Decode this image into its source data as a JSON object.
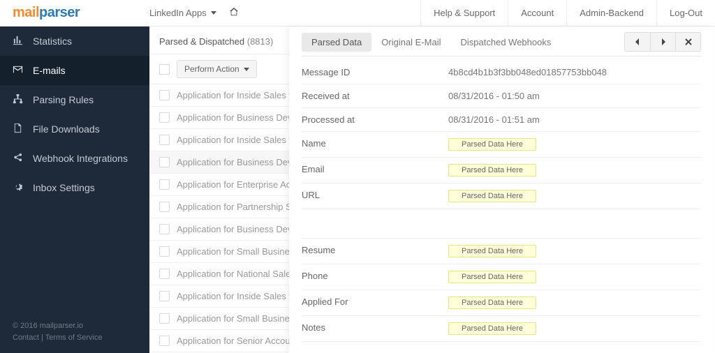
{
  "logo": {
    "a": "mail",
    "b": "parser"
  },
  "top": {
    "dropdown": "LinkedIn Apps",
    "menu": [
      "Help & Support",
      "Account",
      "Admin-Backend",
      "Log-Out"
    ]
  },
  "sidebar": {
    "items": [
      {
        "label": "Statistics"
      },
      {
        "label": "E-mails"
      },
      {
        "label": "Parsing Rules"
      },
      {
        "label": "File Downloads"
      },
      {
        "label": "Webhook Integrations"
      },
      {
        "label": "Inbox Settings"
      }
    ],
    "footer": {
      "copyright": "© 2016 mailparser.io",
      "contact": "Contact",
      "sep": " | ",
      "terms": "Terms of Service"
    }
  },
  "list": {
    "title": "Parsed & Dispatched",
    "count": "(8813)",
    "action_btn": "Perform Action",
    "rows": [
      "Application for Inside Sales from John Example",
      "Application for Business Development from John Example",
      "Application for Inside Sales from John Example",
      "Application for Business Development from John Example",
      "Application for Enterprise Account from John Example",
      "Application for Partnership Sales from John Example",
      "Application for Business Development from John Example",
      "Application for Small Business from John Example",
      "Application for National Sales from John Example",
      "Application for Inside Sales from John Example",
      "Application for Small Business from John Example",
      "Application for Senior Account from John Example"
    ],
    "selected_index": 3
  },
  "detail": {
    "tabs": [
      "Parsed Data",
      "Original E-Mail",
      "Dispatched Webhooks"
    ],
    "active_tab": 0,
    "placeholder": "Parsed Data Here",
    "fields1": [
      {
        "label": "Message ID",
        "value": "4b8cd4b1b3f3bb048ed01857753bb048",
        "parsed": false
      },
      {
        "label": "Received at",
        "value": "08/31/2016 - 01:50 am",
        "parsed": false
      },
      {
        "label": "Processed at",
        "value": "08/31/2016 - 01:51 am",
        "parsed": false
      },
      {
        "label": "Name",
        "value": "",
        "parsed": true
      },
      {
        "label": "Email",
        "value": "",
        "parsed": true
      },
      {
        "label": "URL",
        "value": "",
        "parsed": true
      }
    ],
    "fields2": [
      {
        "label": "Resume",
        "value": "",
        "parsed": true
      },
      {
        "label": "Phone",
        "value": "",
        "parsed": true
      },
      {
        "label": "Applied For",
        "value": "",
        "parsed": true
      },
      {
        "label": "Notes",
        "value": "",
        "parsed": true
      }
    ]
  }
}
